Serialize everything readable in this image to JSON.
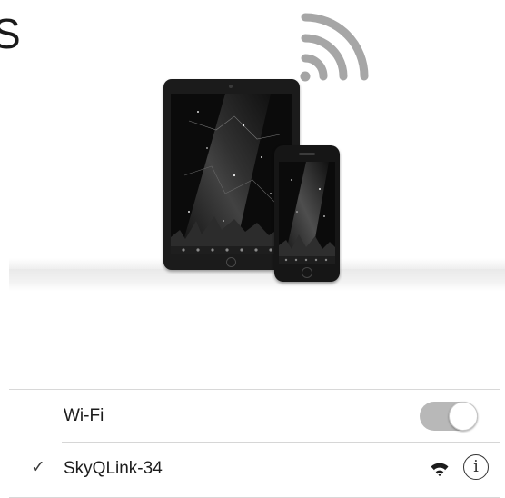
{
  "header": {
    "cropped_text": "S"
  },
  "settings": {
    "wifi": {
      "label": "Wi-Fi",
      "toggle_on": true
    },
    "network": {
      "checkmark": "✓",
      "name": "SkyQLink-34",
      "info_glyph": "i"
    }
  },
  "icons": {
    "signal": "wifi-signal-icon",
    "strength": "wifi-strength-icon",
    "info": "info-icon",
    "check": "checkmark-icon"
  },
  "colors": {
    "toggle_track": "#b8b8b8",
    "device_body": "#1b1b1b",
    "signal_arcs": "#a6a6a6"
  }
}
